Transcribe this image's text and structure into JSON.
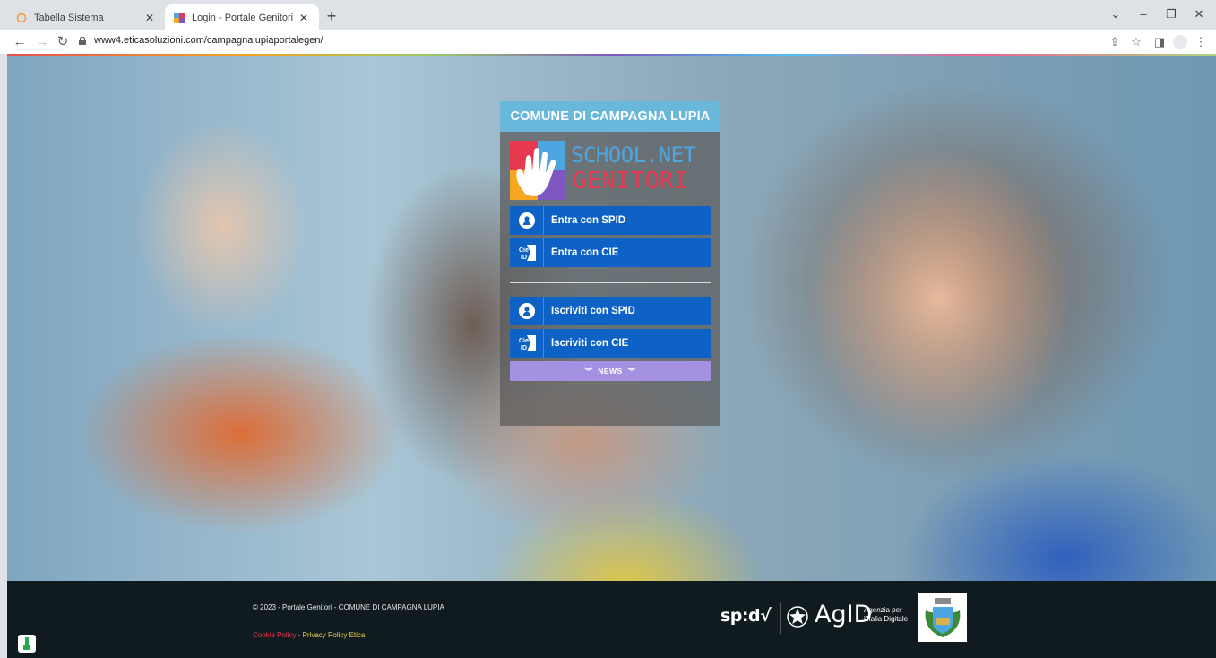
{
  "browser": {
    "tabs": [
      {
        "title": "Tabella Sistema",
        "active": false
      },
      {
        "title": "Login - Portale Genitori",
        "active": true
      }
    ],
    "url": "www4.eticasoluzioni.com/campagnalupiaportalegen/"
  },
  "card": {
    "header": "COMUNE DI CAMPAGNA LUPIA",
    "logo_line1": "SCHOOL.NET",
    "logo_line2": "GENITORI",
    "buttons": [
      {
        "label": "Entra con SPID",
        "icon": "spid-user-icon"
      },
      {
        "label": "Entra con CIE",
        "icon": "cie-id-icon"
      },
      {
        "label": "Iscriviti con SPID",
        "icon": "spid-user-icon"
      },
      {
        "label": "Iscriviti con CIE",
        "icon": "cie-id-icon"
      }
    ],
    "news_label": "NEWS",
    "colors": {
      "header": "#69b8dc",
      "button": "#0e62c6",
      "news": "#a491e2"
    }
  },
  "footer": {
    "copyright": "© 2023 - Portale Genitori - COMUNE DI CAMPAGNA LUPIA",
    "cookie_link": "Cookie Policy",
    "separator": " - ",
    "privacy_link": "Privacy Policy Etica",
    "spid_logo": "sp:d√",
    "agid_logo": "AgID",
    "agid_sub1": "Agenzia per",
    "agid_sub2": "l'Italia Digitale"
  }
}
